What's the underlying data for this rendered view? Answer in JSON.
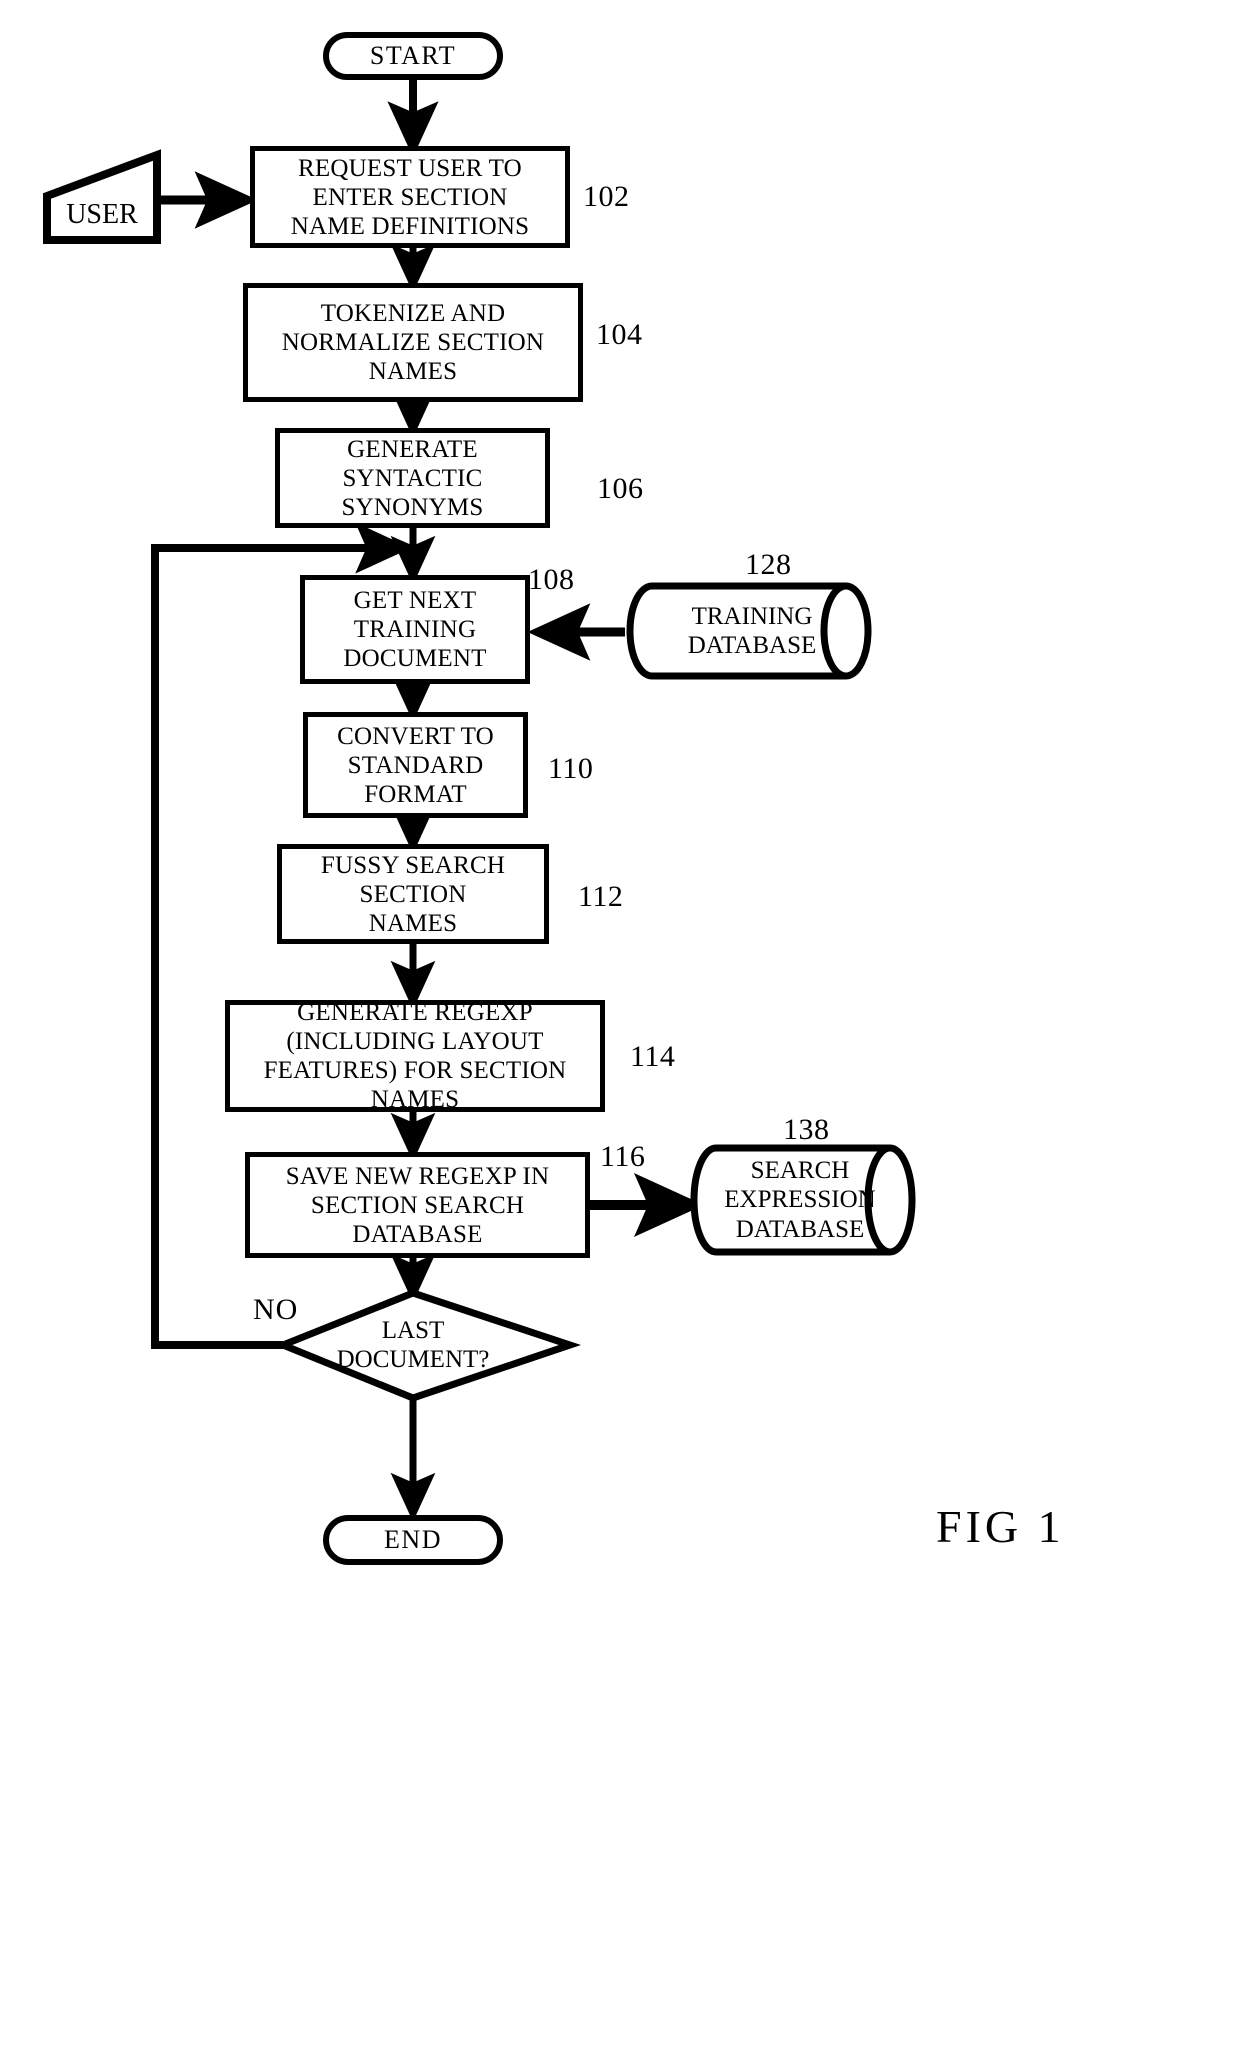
{
  "figure": {
    "caption": "FIG  1"
  },
  "nodes": {
    "start": {
      "label": "START"
    },
    "user": {
      "label": "USER"
    },
    "request_user": {
      "lines": [
        "REQUEST USER TO",
        "ENTER SECTION",
        "NAME DEFINITIONS"
      ],
      "ref": "102"
    },
    "tokenize": {
      "lines": [
        "TOKENIZE AND",
        "NORMALIZE SECTION",
        "NAMES"
      ],
      "ref": "104"
    },
    "synonyms": {
      "lines": [
        "GENERATE",
        "SYNTACTIC",
        "SYNONYMS"
      ],
      "ref": "106"
    },
    "get_next_doc": {
      "lines": [
        "GET NEXT",
        "TRAINING",
        "DOCUMENT"
      ],
      "ref": "108"
    },
    "training_db": {
      "lines": [
        "TRAINING",
        "DATABASE"
      ],
      "ref": "128"
    },
    "convert": {
      "lines": [
        "CONVERT TO",
        "STANDARD",
        "FORMAT"
      ],
      "ref": "110"
    },
    "fussy_search": {
      "lines": [
        "FUSSY SEARCH",
        "SECTION",
        "NAMES"
      ],
      "ref": "112"
    },
    "generate_regexp": {
      "lines": [
        "GENERATE REGEXP",
        "(INCLUDING  LAYOUT",
        "FEATURES)  FOR SECTION",
        "NAMES"
      ],
      "ref": "114"
    },
    "save_regexp": {
      "lines": [
        "SAVE NEW REGEXP IN",
        "SECTION SEARCH",
        "DATABASE"
      ],
      "ref": "116"
    },
    "search_expr_db": {
      "lines": [
        "SEARCH",
        "EXPRESSION",
        "DATABASE"
      ],
      "ref": "138"
    },
    "decision": {
      "lines": [
        "LAST",
        "DOCUMENT?"
      ],
      "no_label": "NO"
    },
    "end": {
      "label": "END"
    }
  },
  "colors": {
    "ink": "#000000",
    "paper": "#ffffff"
  }
}
